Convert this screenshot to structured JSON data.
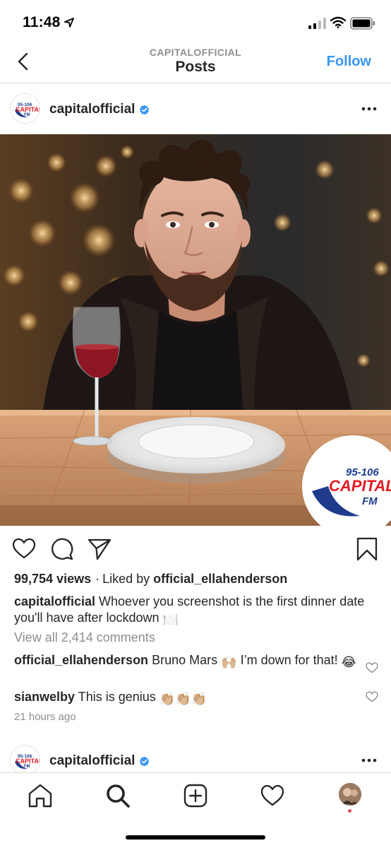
{
  "status": {
    "time": "11:48"
  },
  "nav": {
    "subtitle": "CAPITALOFFICIAL",
    "title": "Posts",
    "follow_label": "Follow"
  },
  "post": {
    "username": "capitalofficial",
    "views": "99,754 views",
    "liked_prefix": "Liked by",
    "liked_by": "official_ellahenderson",
    "caption_user": "capitalofficial",
    "caption_text": "Whoever you screenshot is the first dinner date you'll have after lockdown",
    "caption_emoji": "🍽️",
    "view_comments": "View all 2,414 comments",
    "comments": [
      {
        "user": "official_ellahenderson",
        "text_a": "Bruno Mars",
        "emoji_a": "🙌🏼",
        "text_b": "I’m down for that!",
        "emoji_b": "😂"
      },
      {
        "user": "sianwelby",
        "text_a": "This is genius",
        "emoji_a": "👏🏼👏🏼👏🏼"
      }
    ],
    "time_ago": "21 hours ago",
    "logo": {
      "line1": "95-106",
      "line2": "CAPITAL",
      "line3": "FM"
    }
  },
  "next_post": {
    "username": "capitalofficial"
  },
  "icons": {
    "status": [
      "location-arrow-icon",
      "signal-icon",
      "wifi-icon",
      "battery-icon"
    ],
    "nav": [
      "back-chevron-icon"
    ],
    "actions": [
      "heart-icon",
      "comment-icon",
      "share-icon",
      "bookmark-icon"
    ],
    "tabs": [
      "home-icon",
      "search-icon",
      "new-post-icon",
      "activity-heart-icon",
      "profile-icon"
    ]
  },
  "colors": {
    "accent": "#3897f0",
    "verified": "#3897f0",
    "notification": "#ed4956",
    "capital_blue": "#1f3c8c",
    "capital_red": "#e21a23"
  }
}
